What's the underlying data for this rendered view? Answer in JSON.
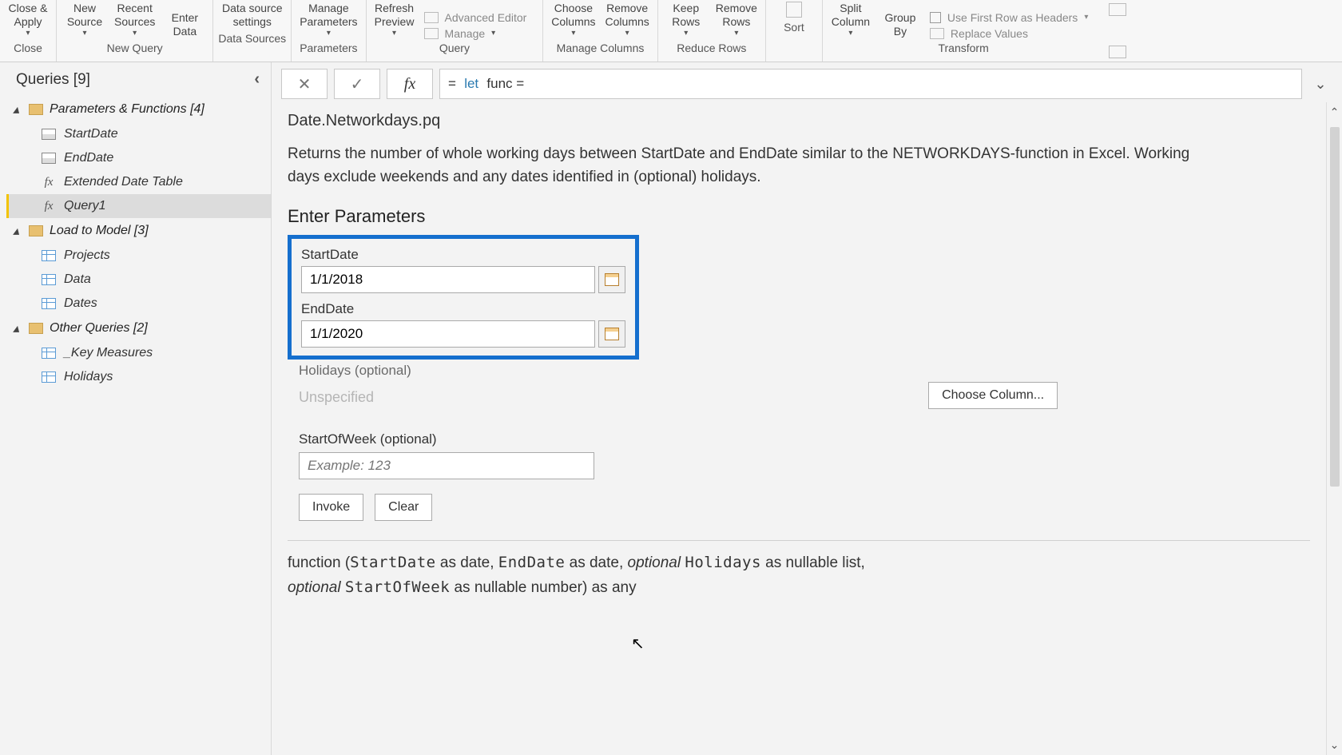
{
  "ribbon": {
    "groups": [
      {
        "name": "Close",
        "items": [
          {
            "label": "Close &\nApply",
            "arrow": true
          }
        ]
      },
      {
        "name": "New Query",
        "items": [
          {
            "label": "New\nSource",
            "arrow": true
          },
          {
            "label": "Recent\nSources",
            "arrow": true
          },
          {
            "label": "Enter\nData",
            "arrow": false
          }
        ]
      },
      {
        "name": "Data Sources",
        "items": [
          {
            "label": "Data source\nsettings",
            "arrow": false
          }
        ]
      },
      {
        "name": "Parameters",
        "items": [
          {
            "label": "Manage\nParameters",
            "arrow": true
          }
        ]
      },
      {
        "name": "Query",
        "items": [
          {
            "label": "Refresh\nPreview",
            "arrow": true
          }
        ],
        "extras": [
          {
            "label": "Advanced Editor"
          },
          {
            "label": "Manage",
            "arrow": true
          }
        ]
      },
      {
        "name": "Manage Columns",
        "items": [
          {
            "label": "Choose\nColumns",
            "arrow": true
          },
          {
            "label": "Remove\nColumns",
            "arrow": true
          }
        ]
      },
      {
        "name": "Reduce Rows",
        "items": [
          {
            "label": "Keep\nRows",
            "arrow": true
          },
          {
            "label": "Remove\nRows",
            "arrow": true
          }
        ]
      },
      {
        "name": "Sort",
        "items": []
      },
      {
        "name": "Transform",
        "items": [
          {
            "label": "Split\nColumn",
            "arrow": true
          },
          {
            "label": "Group\nBy",
            "arrow": false
          }
        ],
        "side": [
          {
            "label": "Use First Row as Headers",
            "arrow": true
          },
          {
            "label": "Replace Values"
          }
        ]
      }
    ]
  },
  "sidebar": {
    "title": "Queries [9]",
    "folders": [
      {
        "name": "Parameters & Functions [4]",
        "items": [
          {
            "type": "param",
            "label": "StartDate"
          },
          {
            "type": "param",
            "label": "EndDate"
          },
          {
            "type": "fx",
            "label": "Extended Date Table"
          },
          {
            "type": "fx",
            "label": "Query1",
            "selected": true
          }
        ]
      },
      {
        "name": "Load to Model [3]",
        "items": [
          {
            "type": "table",
            "label": "Projects"
          },
          {
            "type": "table",
            "label": "Data"
          },
          {
            "type": "table",
            "label": "Dates"
          }
        ]
      },
      {
        "name": "Other Queries [2]",
        "items": [
          {
            "type": "table",
            "label": "_Key Measures"
          },
          {
            "type": "table",
            "label": "Holidays"
          }
        ]
      }
    ]
  },
  "formula": {
    "prefix": "=",
    "kw": "let",
    "rest": "func ="
  },
  "page": {
    "title": "Date.Networkdays.pq",
    "description": "Returns the number of whole working days between StartDate and EndDate similar to the NETWORKDAYS-function in Excel. Working days exclude weekends and any dates identified in (optional) holidays.",
    "section": "Enter Parameters",
    "params": {
      "start_label": "StartDate",
      "start_value": "1/1/2018",
      "end_label": "EndDate",
      "end_value": "1/1/2020",
      "holidays_label": "Holidays (optional)",
      "holidays_placeholder": "Unspecified",
      "choose_column": "Choose Column...",
      "sow_label": "StartOfWeek (optional)",
      "sow_placeholder": "Example: 123"
    },
    "buttons": {
      "invoke": "Invoke",
      "clear": "Clear"
    },
    "sig": {
      "fn": "function",
      "p1": "StartDate",
      "t1": "as date,",
      "p2": "EndDate",
      "t2": "as date,",
      "opt": "optional",
      "p3": "Holidays",
      "t3": "as nullable list,",
      "p4": "StartOfWeek",
      "t4": "as nullable number) as any"
    }
  }
}
